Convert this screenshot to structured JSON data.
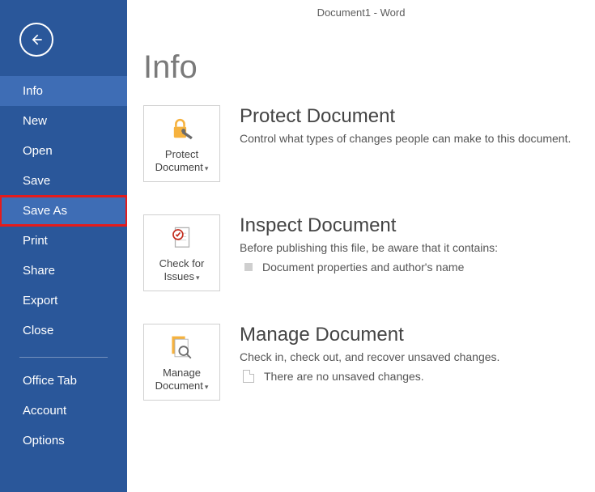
{
  "titlebar": "Document1 - Word",
  "page_title": "Info",
  "sidebar": {
    "items": [
      {
        "label": "Info"
      },
      {
        "label": "New"
      },
      {
        "label": "Open"
      },
      {
        "label": "Save"
      },
      {
        "label": "Save As"
      },
      {
        "label": "Print"
      },
      {
        "label": "Share"
      },
      {
        "label": "Export"
      },
      {
        "label": "Close"
      }
    ],
    "lower_items": [
      {
        "label": "Office Tab"
      },
      {
        "label": "Account"
      },
      {
        "label": "Options"
      }
    ]
  },
  "sections": {
    "protect": {
      "tile_line1": "Protect",
      "tile_line2": "Document",
      "title": "Protect Document",
      "desc": "Control what types of changes people can make to this document."
    },
    "inspect": {
      "tile_line1": "Check for",
      "tile_line2": "Issues",
      "title": "Inspect Document",
      "desc": "Before publishing this file, be aware that it contains:",
      "bullet": "Document properties and author's name"
    },
    "manage": {
      "tile_line1": "Manage",
      "tile_line2": "Document",
      "title": "Manage Document",
      "desc": "Check in, check out, and recover unsaved changes.",
      "bullet": "There are no unsaved changes."
    }
  }
}
